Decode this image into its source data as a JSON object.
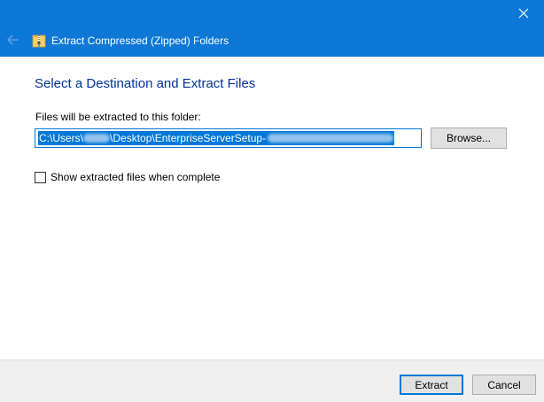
{
  "window": {
    "title": "Extract Compressed (Zipped) Folders",
    "accent_color": "#0e78d7",
    "close_icon": "close-icon",
    "back_icon": "back-arrow-icon"
  },
  "content": {
    "heading": "Select a Destination and Extract Files",
    "destination_label": "Files will be extracted to this folder:",
    "path_start": "C:\\Users\\",
    "path_middle": "\\Desktop\\EnterpriseServerSetup-",
    "browse_label": "Browse...",
    "show_files_label": "Show extracted files when complete",
    "show_files_checked": false
  },
  "footer": {
    "extract_label": "Extract",
    "cancel_label": "Cancel"
  }
}
